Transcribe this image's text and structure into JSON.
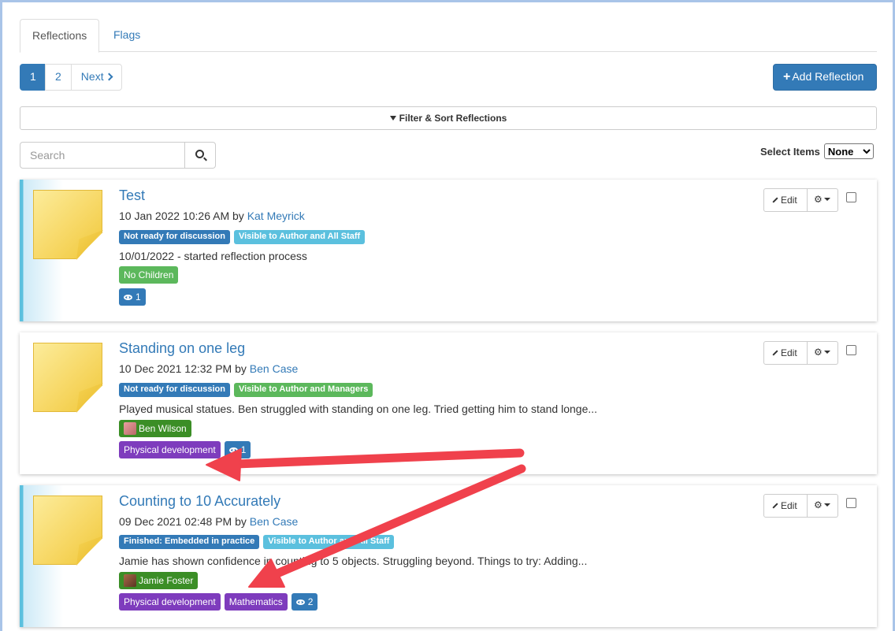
{
  "tabs": [
    {
      "label": "Reflections",
      "active": true
    },
    {
      "label": "Flags",
      "active": false
    }
  ],
  "pagination": {
    "pages": [
      "1",
      "2"
    ],
    "current": "1",
    "next_label": "Next"
  },
  "add_button": {
    "label": "Add Reflection"
  },
  "filter": {
    "label": "Filter & Sort Reflections"
  },
  "search": {
    "placeholder": "Search"
  },
  "select_items": {
    "label": "Select Items",
    "value": "None",
    "options": [
      "None"
    ]
  },
  "actions": {
    "edit_label": "Edit"
  },
  "reflections": [
    {
      "title": "Test",
      "date": "10 Jan 2022 10:26 AM",
      "by": "by",
      "author": "Kat Meyrick",
      "status": {
        "text": "Not ready for discussion",
        "color": "#337ab7"
      },
      "visibility": {
        "text": "Visible to Author and All Staff",
        "color": "#5bc0de"
      },
      "description": "10/01/2022 - started reflection process",
      "children_tag": "No Children",
      "views": "1"
    },
    {
      "title": "Standing on one leg",
      "date": "10 Dec 2021 12:32 PM",
      "by": "by",
      "author": "Ben Case",
      "status": {
        "text": "Not ready for discussion",
        "color": "#337ab7"
      },
      "visibility": {
        "text": "Visible to Author and Managers",
        "color": "#5cb85c"
      },
      "description": "Played musical statues. Ben struggled with standing on one leg. Tried getting him to stand longe...",
      "child": "Ben Wilson",
      "area": "Physical development",
      "views": "1"
    },
    {
      "title": "Counting to 10 Accurately",
      "date": "09 Dec 2021 02:48 PM",
      "by": "by",
      "author": "Ben Case",
      "status": {
        "text": "Finished: Embedded in practice",
        "color": "#337ab7"
      },
      "visibility": {
        "text": "Visible to Author and All Staff",
        "color": "#5bc0de"
      },
      "description": "Jamie has shown confidence in counting to 5 objects. Struggling beyond. Things to try: Adding...",
      "child": "Jamie Foster",
      "area": "Physical development",
      "area2": "Mathematics",
      "views": "2"
    }
  ],
  "colors": {
    "primary": "#337ab7",
    "accent_info": "#5bc0de",
    "success": "#5cb85c",
    "purple": "#7e3cbd",
    "arrow": "#f0414c"
  }
}
